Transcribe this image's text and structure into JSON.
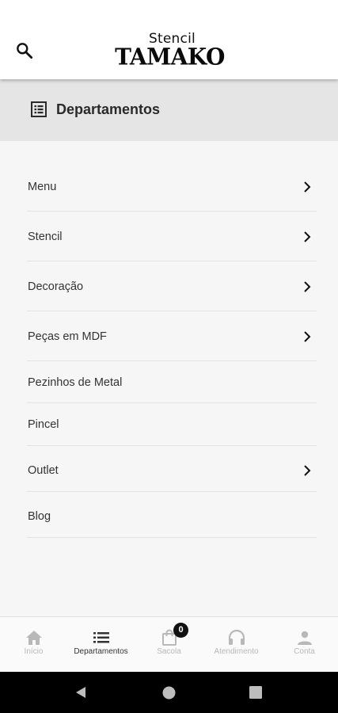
{
  "header": {
    "logo_small": "Stencil",
    "logo_big": "TAMAKO",
    "search_icon": "search-icon"
  },
  "departments_header": {
    "title": "Departamentos",
    "icon": "list-box-icon",
    "background": "#e5e5e5"
  },
  "menu": {
    "items": [
      {
        "label": "Menu",
        "has_submenu": true
      },
      {
        "label": "Stencil",
        "has_submenu": true
      },
      {
        "label": "Decoração",
        "has_submenu": true
      },
      {
        "label": "Peças em MDF",
        "has_submenu": true
      },
      {
        "label": "Pezinhos de Metal",
        "has_submenu": false
      },
      {
        "label": "Pincel",
        "has_submenu": false
      },
      {
        "label": "Outlet",
        "has_submenu": true
      },
      {
        "label": "Blog",
        "has_submenu": false
      }
    ]
  },
  "bottom_nav": {
    "active": "Departamentos",
    "tabs": [
      {
        "label": "Início",
        "icon": "home-icon"
      },
      {
        "label": "Departamentos",
        "icon": "list-icon"
      },
      {
        "label": "Sacola",
        "icon": "shopping-bag-icon"
      },
      {
        "label": "Atendimento",
        "icon": "headset-icon"
      },
      {
        "label": "Conta",
        "icon": "person-icon"
      }
    ],
    "cart_count": "0"
  },
  "system_nav": {
    "buttons": [
      "back-icon",
      "home-circle-icon",
      "recents-icon"
    ]
  },
  "colors": {
    "background": "#f6f6f6",
    "text": "#333333",
    "inactive_tab": "#b8b8b8",
    "system_bar": "#000000"
  }
}
